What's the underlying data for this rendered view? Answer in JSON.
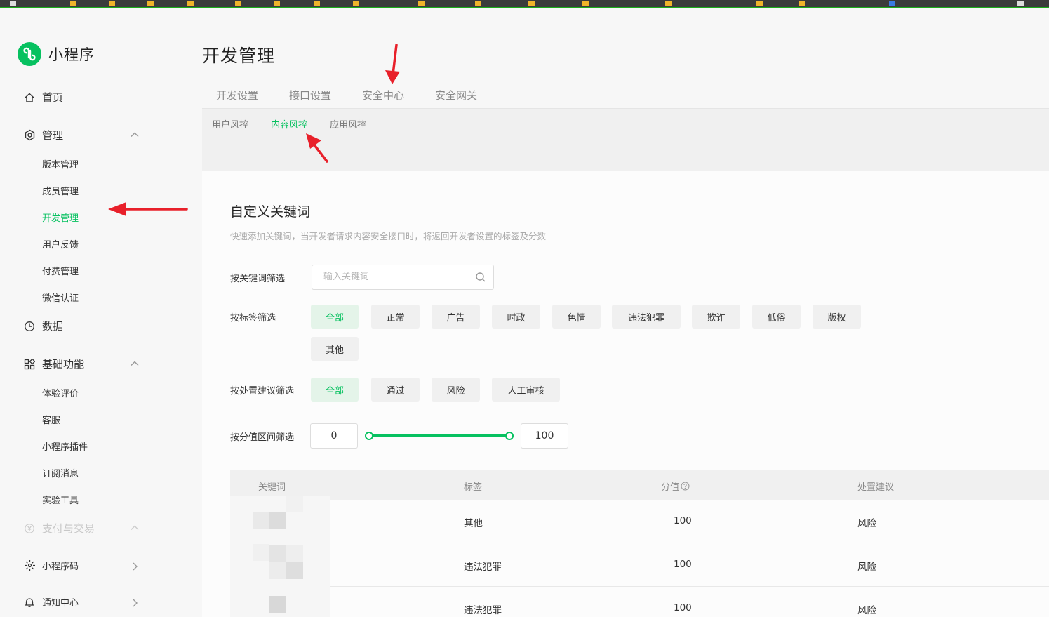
{
  "app": {
    "name": "小程序"
  },
  "sidebar": {
    "home": "首页",
    "manage": "管理",
    "manage_items": [
      "版本管理",
      "成员管理",
      "开发管理",
      "用户反馈",
      "付费管理",
      "微信认证"
    ],
    "data": "数据",
    "basic": "基础功能",
    "basic_items": [
      "体验评价",
      "客服",
      "小程序插件",
      "订阅消息",
      "实验工具"
    ],
    "payment": "支付与交易",
    "qrcode": "小程序码",
    "notify": "通知中心",
    "active_item": "开发管理"
  },
  "page": {
    "title": "开发管理",
    "tabs": [
      "开发设置",
      "接口设置",
      "安全中心",
      "安全网关"
    ],
    "subtabs": [
      "用户风控",
      "内容风控",
      "应用风控"
    ],
    "active_subtab": "内容风控"
  },
  "section": {
    "title": "自定义关键词",
    "desc": "快速添加关键词，当开发者请求内容安全接口时，将返回开发者设置的标签及分数"
  },
  "filters": {
    "keyword_label": "按关键词筛选",
    "keyword_placeholder": "输入关键词",
    "tag_label": "按标签筛选",
    "tags": [
      "全部",
      "正常",
      "广告",
      "时政",
      "色情",
      "违法犯罪",
      "欺诈",
      "低俗",
      "版权",
      "其他"
    ],
    "active_tag": "全部",
    "suggest_label": "按处置建议筛选",
    "suggests": [
      "全部",
      "通过",
      "风险",
      "人工审核"
    ],
    "active_suggest": "全部",
    "score_label": "按分值区间筛选",
    "score_min": "0",
    "score_max": "100"
  },
  "table": {
    "headers": [
      "关键词",
      "标签",
      "分值",
      "处置建议"
    ],
    "rows": [
      {
        "tag": "其他",
        "score": "100",
        "suggest": "风险"
      },
      {
        "tag": "违法犯罪",
        "score": "100",
        "suggest": "风险"
      },
      {
        "tag": "违法犯罪",
        "score": "100",
        "suggest": "风险"
      }
    ]
  },
  "colors": {
    "accent": "#07c160",
    "annotation": "#e8202a"
  }
}
